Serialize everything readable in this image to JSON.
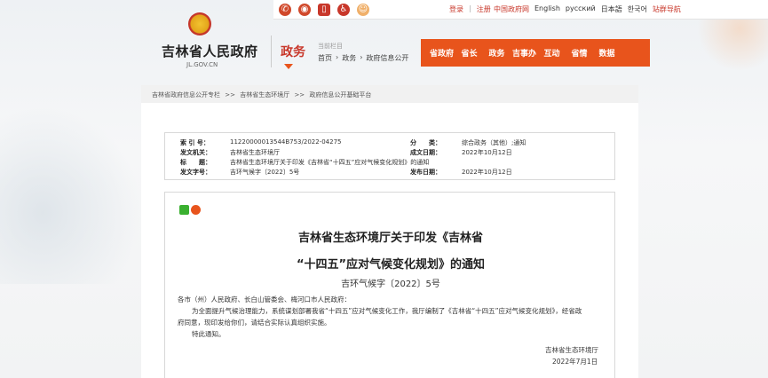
{
  "topbar": {
    "icons": [
      "wechat-icon",
      "weibo-icon",
      "mobile-icon",
      "accessibility-icon",
      "mascot-icon"
    ],
    "login": "登录",
    "register": "注册",
    "langs": [
      "中国政府网",
      "English",
      "русский",
      "日本語",
      "한국어",
      "站群导航"
    ]
  },
  "header": {
    "site_name": "吉林省人民政府",
    "site_domain": "JL.GOV.CN",
    "section": "政务",
    "current_label": "当前栏目",
    "path": [
      "首页",
      "›",
      "政务",
      "›",
      "政府信息公开"
    ]
  },
  "nav": {
    "items": [
      "省政府",
      "省长",
      "政务",
      "吉事办",
      "互动",
      "省情",
      "数据"
    ]
  },
  "breadcrumb": [
    "吉林省政府信息公开专栏",
    ">>",
    "吉林省生态环境厅",
    ">>",
    "政府信息公开基础平台"
  ],
  "meta": {
    "index_label": "索 引 号：",
    "index_value": "11220000013544B753/2022-04275",
    "category_label": "分　　类：",
    "category_value": "综合政务（其他）;通知",
    "org_label": "发文机关：",
    "org_value": "吉林省生态环境厅",
    "created_label": "成文日期：",
    "created_value": "2022年10月12日",
    "title_label": "标　　题：",
    "title_value": "吉林省生态环境厅关于印发《吉林省“十四五”应对气候变化规划》的通知",
    "docnum_label": "发文字号：",
    "docnum_value": "吉环气候字〔2022〕5号",
    "published_label": "发布日期：",
    "published_value": "2022年10月12日"
  },
  "doc": {
    "title_line1": "吉林省生态环境厅关于印发《吉林省",
    "title_line2": "“十四五”应对气候变化规划》的通知",
    "number": "吉环气候字〔2022〕5号",
    "recipients": "各市（州）人民政府、长白山管委会、梅河口市人民政府：",
    "para1_line1": "为全面提升气候治理能力，系统谋划部署我省“十四五”应对气候变化工作，我厅编制了《吉林省“十四五”应对气候变化规划》，经省政",
    "para1_line2": "府同意，现印发给你们，请结合实际认真组织实施。",
    "para2": "特此通知。",
    "signer": "吉林省生态环境厅",
    "date": "2022年7月1日"
  }
}
